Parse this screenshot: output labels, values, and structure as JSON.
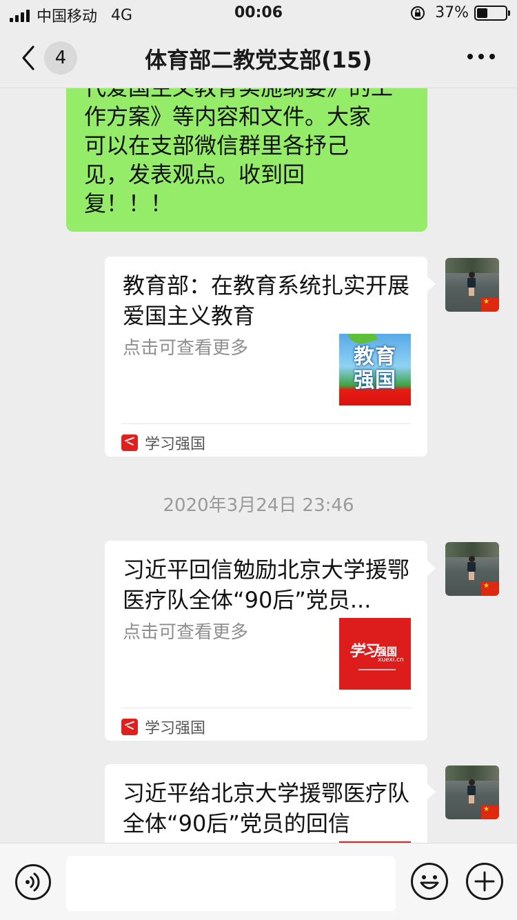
{
  "status_bar": {
    "carrier": "中国移动",
    "network": "4G",
    "time": "00:06",
    "battery": "37%",
    "battery_level": 0.37
  },
  "nav": {
    "unread_count": "4",
    "title": "体育部二教党支部(15)"
  },
  "messages": {
    "text_bubble": {
      "lines": [
        "代爱国主义教育实施纲要》的工",
        "作方案》等内容和文件。大家",
        "可以在支部微信群里各抒己",
        "见，发表观点。收到回",
        "复！！！"
      ]
    },
    "card1": {
      "title": "教育部：在教育系统扎实开展爱国主义教育",
      "desc": "点击可查看更多",
      "thumb_line1": "教育",
      "thumb_line2": "强国",
      "source": "学习强国"
    },
    "timestamp": "2020年3月24日 23:46",
    "card2": {
      "title": "习近平回信勉励北京大学援鄂医疗队全体“90后”党员...",
      "desc": "点击可查看更多",
      "thumb_script": "学习",
      "thumb_name": "强国",
      "thumb_url": "xuexi.cn",
      "source": "学习强国"
    },
    "card3": {
      "title": "习近平给北京大学援鄂医疗队全体“90后”党员的回信"
    }
  },
  "input_bar": {
    "placeholder": ""
  },
  "colors": {
    "sent_bubble": "#95ec69",
    "background": "#ededed",
    "source_red": "#e0201c"
  }
}
